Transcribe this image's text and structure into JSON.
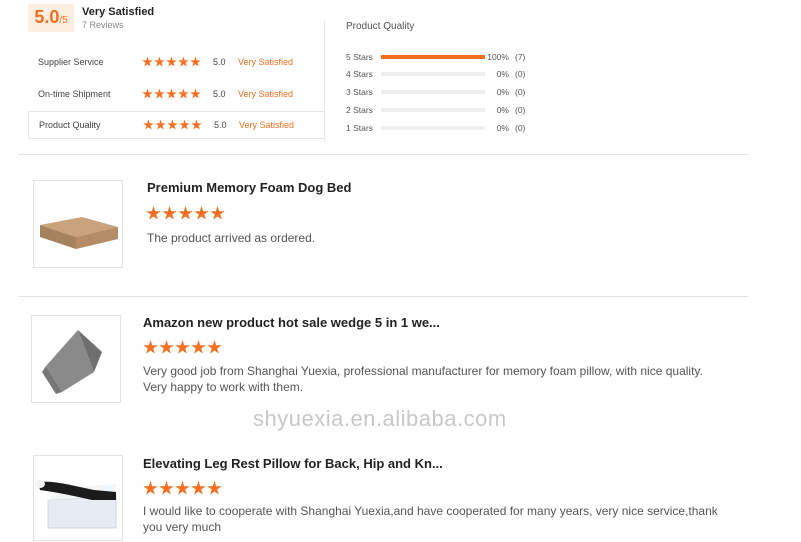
{
  "summary": {
    "score": "5.0",
    "score_denominator": "/5",
    "title": "Very Satisfied",
    "reviews_count": "7 Reviews",
    "ratings": [
      {
        "label": "Supplier Service",
        "value": "5.0",
        "verdict": "Very Satisfied"
      },
      {
        "label": "On-time Shipment",
        "value": "5.0",
        "verdict": "Very Satisfied"
      },
      {
        "label": "Product Quality",
        "value": "5.0",
        "verdict": "Very Satisfied"
      }
    ],
    "star_rating": 5
  },
  "distribution": {
    "title": "Product Quality",
    "rows": [
      {
        "label": "5 Stars",
        "percent": "100%",
        "count": "(7)",
        "fraction": 1.0
      },
      {
        "label": "4 Stars",
        "percent": "0%",
        "count": "(0)",
        "fraction": 0
      },
      {
        "label": "3 Stars",
        "percent": "0%",
        "count": "(0)",
        "fraction": 0
      },
      {
        "label": "2 Stars",
        "percent": "0%",
        "count": "(0)",
        "fraction": 0
      },
      {
        "label": "1 Stars",
        "percent": "0%",
        "count": "(0)",
        "fraction": 0
      }
    ]
  },
  "reviews": [
    {
      "title": "Premium Memory Foam Dog Bed",
      "stars": 5,
      "text": "The product arrived as ordered."
    },
    {
      "title": "Amazon new product hot sale wedge 5 in 1 we...",
      "stars": 5,
      "text": "Very good job from Shanghai Yuexia, professional manufacturer for memory foam pillow, with nice quality. Very happy to work with them."
    },
    {
      "title": "Elevating Leg Rest Pillow for Back, Hip and Kn...",
      "stars": 5,
      "text": "I would like to cooperate with Shanghai Yuexia,and have cooperated for many years, very nice service,thank you very much"
    }
  ],
  "watermark": "shyuexia.en.alibaba.com",
  "colors": {
    "accent": "#f36f21",
    "accent_bg": "#fdeee2"
  }
}
